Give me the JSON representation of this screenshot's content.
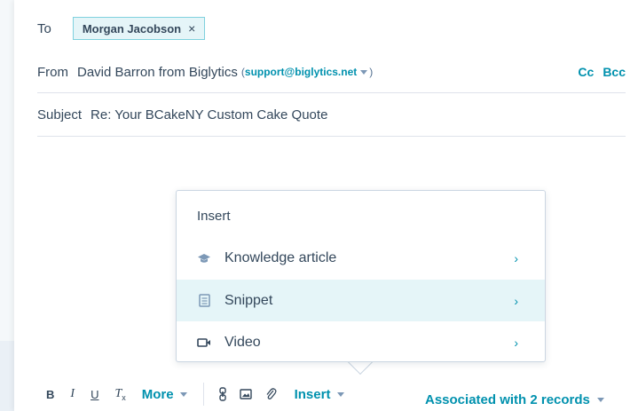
{
  "recipients": {
    "to_label": "To",
    "chip_name": "Morgan Jacobson",
    "chip_close": "×"
  },
  "from": {
    "label": "From",
    "sender": "David Barron from Biglytics",
    "email_open": "(",
    "email": "support@biglytics.net",
    "email_close": ")",
    "cc": "Cc",
    "bcc": "Bcc"
  },
  "subject": {
    "label": "Subject",
    "value": "Re: Your BCakeNY Custom Cake Quote"
  },
  "insert_menu": {
    "header": "Insert",
    "items": [
      {
        "label": "Knowledge article",
        "icon": "graduation-cap-icon",
        "chevron": "›"
      },
      {
        "label": "Snippet",
        "icon": "document-icon",
        "chevron": "›",
        "active": true
      },
      {
        "label": "Video",
        "icon": "video-icon",
        "chevron": "›"
      }
    ]
  },
  "toolbar": {
    "bold": "B",
    "italic": "I",
    "underline": "U",
    "clear_format": "T",
    "more": "More",
    "insert": "Insert",
    "associated": "Associated with 2 records"
  },
  "colors": {
    "accent": "#0091ae",
    "text": "#33475b",
    "chip_bg": "#e5f5f8",
    "chip_border": "#7fd1de",
    "active_row": "#e5f5f8"
  }
}
